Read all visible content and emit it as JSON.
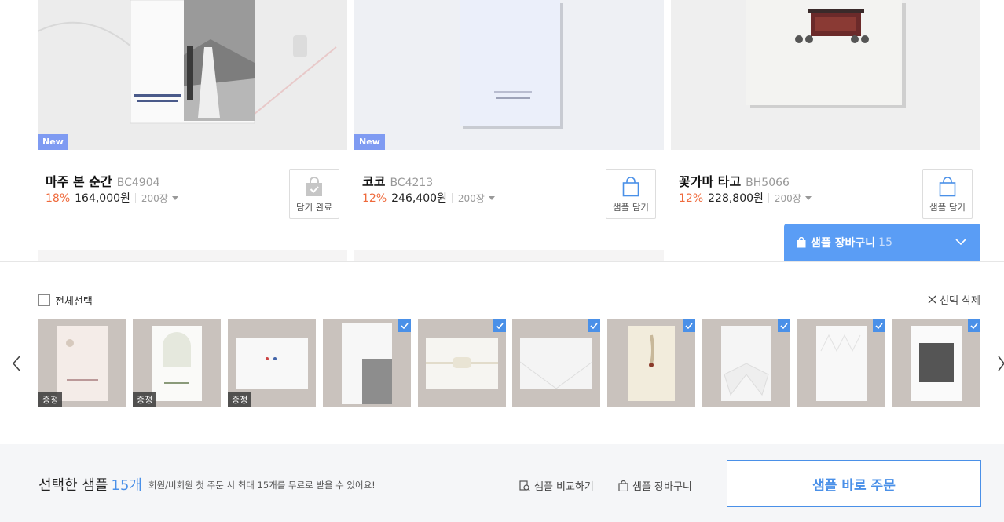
{
  "products": [
    {
      "name": "마주 본 순간",
      "code": "BC4904",
      "discount": "18%",
      "price": "164,000원",
      "qty": "200장",
      "badge": "New",
      "button_label": "담기 완료",
      "added": true
    },
    {
      "name": "코코",
      "code": "BC4213",
      "discount": "12%",
      "price": "246,400원",
      "qty": "200장",
      "badge": "New",
      "button_label": "샘플 담기",
      "added": false
    },
    {
      "name": "꽃가마 타고",
      "code": "BH5066",
      "discount": "12%",
      "price": "228,800원",
      "qty": "200장",
      "badge": "",
      "button_label": "샘플 담기",
      "added": false
    }
  ],
  "sample_cart": {
    "title": "샘플 장바구니",
    "count": "15"
  },
  "drawer": {
    "select_all_label": "전체선택",
    "delete_selected_label": "선택 삭제",
    "thumbnails": [
      {
        "gift_label": "증정",
        "checked": false
      },
      {
        "gift_label": "증정",
        "checked": false
      },
      {
        "gift_label": "증정",
        "checked": false
      },
      {
        "gift_label": "",
        "checked": true
      },
      {
        "gift_label": "",
        "checked": true
      },
      {
        "gift_label": "",
        "checked": true
      },
      {
        "gift_label": "",
        "checked": true
      },
      {
        "gift_label": "",
        "checked": true
      },
      {
        "gift_label": "",
        "checked": true
      },
      {
        "gift_label": "",
        "checked": true
      }
    ]
  },
  "footer": {
    "selected_label": "선택한 샘플",
    "selected_count": "15개",
    "note": "회원/비회원 첫 주문 시 최대 15개를 무료로 받을 수 있어요!",
    "compare_label": "샘플 비교하기",
    "cart_label": "샘플 장바구니",
    "order_label": "샘플 바로 주문"
  },
  "colors": {
    "accent": "#4a90e8",
    "cart_bar": "#5a9df5",
    "discount": "#ef6a3c",
    "new_badge": "#7f9bf2"
  }
}
